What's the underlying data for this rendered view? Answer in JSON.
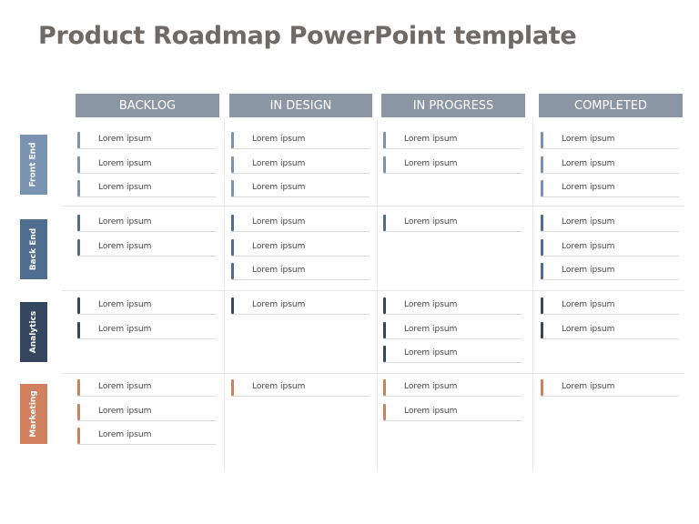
{
  "title": "Product Roadmap PowerPoint template",
  "columns": [
    "BACKLOG",
    "IN DESIGN",
    "IN PROGRESS",
    "COMPLETED"
  ],
  "header_color": "#8a96a3",
  "rows": [
    {
      "label": "Front End",
      "color": "#7a93b0",
      "cells": [
        [
          "Lorem ipsum",
          "Lorem ipsum",
          "Lorem ipsum"
        ],
        [
          "Lorem ipsum",
          "Lorem ipsum",
          "Lorem ipsum"
        ],
        [
          "Lorem ipsum",
          "Lorem ipsum"
        ],
        [
          "Lorem ipsum",
          "Lorem ipsum",
          "Lorem ipsum"
        ]
      ]
    },
    {
      "label": "Back End",
      "color": "#4f6d8f",
      "cells": [
        [
          "Lorem ipsum",
          "Lorem ipsum"
        ],
        [
          "Lorem ipsum",
          "Lorem ipsum",
          "Lorem ipsum"
        ],
        [
          "Lorem ipsum"
        ],
        [
          "Lorem ipsum",
          "Lorem ipsum",
          "Lorem ipsum"
        ]
      ]
    },
    {
      "label": "Analytics",
      "color": "#35475f",
      "cells": [
        [
          "Lorem ipsum",
          "Lorem ipsum"
        ],
        [
          "Lorem ipsum"
        ],
        [
          "Lorem ipsum",
          "Lorem ipsum",
          "Lorem ipsum"
        ],
        [
          "Lorem ipsum",
          "Lorem ipsum"
        ]
      ]
    },
    {
      "label": "Marketing",
      "color": "#d0805f",
      "cells": [
        [
          "Lorem ipsum",
          "Lorem ipsum",
          "Lorem ipsum"
        ],
        [
          "Lorem ipsum"
        ],
        [
          "Lorem ipsum",
          "Lorem ipsum"
        ],
        [
          "Lorem ipsum"
        ]
      ]
    }
  ]
}
